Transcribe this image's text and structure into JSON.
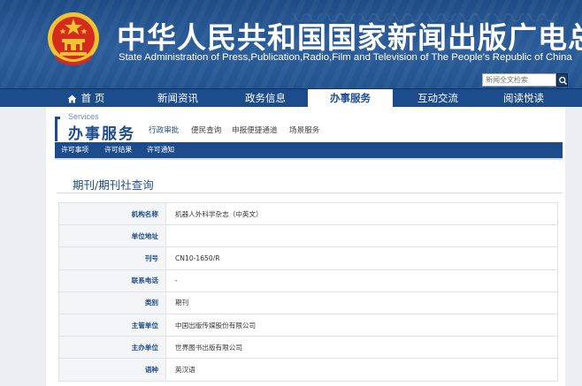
{
  "header": {
    "title_cn": "中华人民共和国国家新闻出版广电总局",
    "title_en": "State Administration of Press,Publication,Radio,Film and Television of The People's Republic of China",
    "search": {
      "placeholder": "新闻全文检索"
    }
  },
  "nav": {
    "items": [
      {
        "label": "首 页",
        "icon": "home-icon"
      },
      {
        "label": "新闻资讯"
      },
      {
        "label": "政务信息"
      },
      {
        "label": "办事服务",
        "active": true
      },
      {
        "label": "互动交流"
      },
      {
        "label": "阅读悦读"
      }
    ]
  },
  "section": {
    "title_en": "Services",
    "title_cn": "办事服务",
    "links": [
      "行政审批",
      "便民查询",
      "申报便捷通道",
      "场景服务"
    ],
    "active_link": "行政审批",
    "subnav": [
      "许可事项",
      "许可结果",
      "许可通知"
    ]
  },
  "page": {
    "title": "期刊/期刊社查询"
  },
  "record": {
    "rows": [
      {
        "label": "机构名称",
        "value": "机器人外科学杂志（中英文）"
      },
      {
        "label": "单位地址",
        "value": ""
      },
      {
        "label": "刊号",
        "value": "CN10-1650/R"
      },
      {
        "label": "联系电话",
        "value": "-"
      },
      {
        "label": "类别",
        "value": "期刊"
      },
      {
        "label": "主管单位",
        "value": "中国出版传媒股份有限公司"
      },
      {
        "label": "主办单位",
        "value": "世界图书出版有限公司"
      },
      {
        "label": "语种",
        "value": "英汉语"
      }
    ]
  },
  "colors": {
    "brand_blue": "#1c4c8c",
    "banner_blue": "#2b5d9a",
    "emblem_red": "#d52b1e",
    "emblem_gold": "#f2c230"
  }
}
